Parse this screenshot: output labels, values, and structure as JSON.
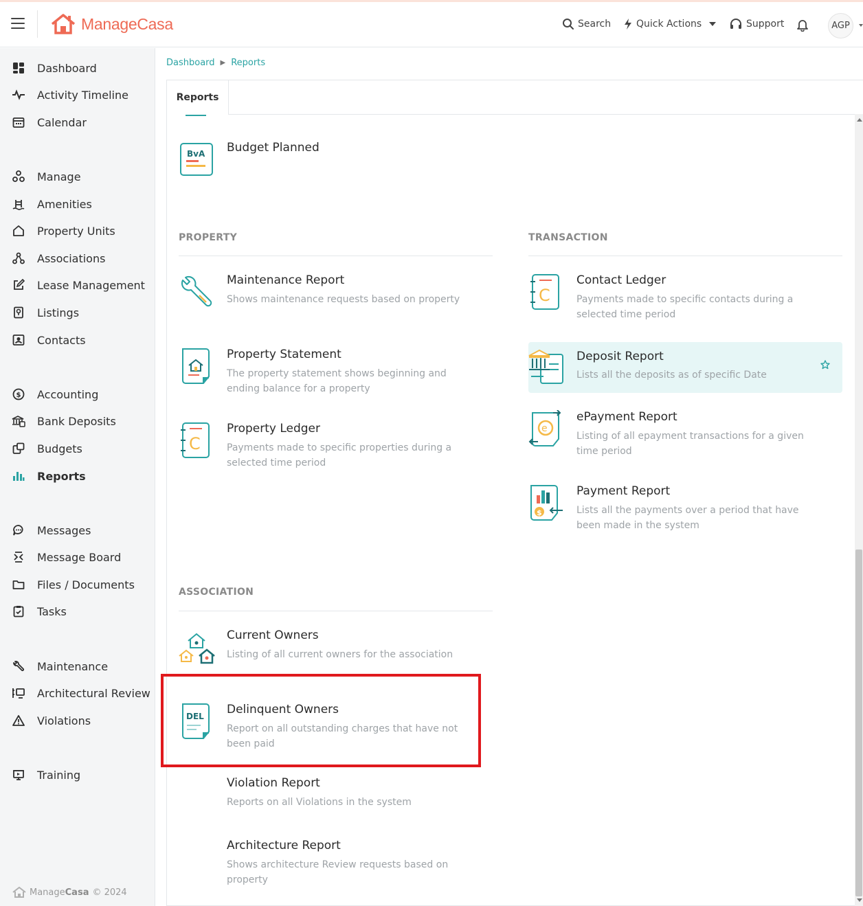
{
  "header": {
    "brand": "ManageCasa",
    "search": "Search",
    "quick_actions": "Quick Actions",
    "support": "Support",
    "avatar": "AGP"
  },
  "sidebar": {
    "items": [
      {
        "label": "Dashboard",
        "icon": "dashboard-icon"
      },
      {
        "label": "Activity Timeline",
        "icon": "pulse-icon"
      },
      {
        "label": "Calendar",
        "icon": "calendar-icon"
      },
      {
        "label": "Manage",
        "icon": "manage-icon"
      },
      {
        "label": "Amenities",
        "icon": "pool-icon"
      },
      {
        "label": "Property Units",
        "icon": "home-icon"
      },
      {
        "label": "Associations",
        "icon": "network-icon"
      },
      {
        "label": "Lease Management",
        "icon": "edit-icon"
      },
      {
        "label": "Listings",
        "icon": "listing-icon"
      },
      {
        "label": "Contacts",
        "icon": "contact-card-icon"
      },
      {
        "label": "Accounting",
        "icon": "dollar-icon"
      },
      {
        "label": "Bank Deposits",
        "icon": "bank-icon"
      },
      {
        "label": "Budgets",
        "icon": "budget-icon"
      },
      {
        "label": "Reports",
        "icon": "bar-chart-icon"
      },
      {
        "label": "Messages",
        "icon": "chat-icon"
      },
      {
        "label": "Message Board",
        "icon": "board-icon"
      },
      {
        "label": "Files / Documents",
        "icon": "folder-icon"
      },
      {
        "label": "Tasks",
        "icon": "task-icon"
      },
      {
        "label": "Maintenance",
        "icon": "wrench-icon"
      },
      {
        "label": "Architectural Review",
        "icon": "review-icon"
      },
      {
        "label": "Violations",
        "icon": "warning-icon"
      },
      {
        "label": "Training",
        "icon": "training-icon"
      }
    ],
    "footer_brand_light": "Manage",
    "footer_brand_bold": "Casa",
    "footer_copyright": "© 2024"
  },
  "breadcrumb": [
    "Dashboard",
    "Reports"
  ],
  "tabs": [
    "Reports"
  ],
  "sections": {
    "property": "PROPERTY",
    "transaction": "TRANSACTION",
    "association": "ASSOCIATION"
  },
  "reports": {
    "budget_planned": {
      "title": "Budget Planned",
      "icon_text": "BvA"
    },
    "maintenance": {
      "title": "Maintenance Report",
      "desc": "Shows maintenance requests based on property"
    },
    "property_statement": {
      "title": "Property Statement",
      "desc": "The property statement shows beginning and ending balance for a property"
    },
    "property_ledger": {
      "title": "Property Ledger",
      "desc": "Payments made to specific properties during a selected time period"
    },
    "contact_ledger": {
      "title": "Contact Ledger",
      "desc": "Payments made to specific contacts during a selected time period"
    },
    "deposit": {
      "title": "Deposit Report",
      "desc": "Lists all the deposits as of specific Date"
    },
    "epayment": {
      "title": "ePayment Report",
      "desc": "Listing of all epayment transactions for a given time period"
    },
    "payment": {
      "title": "Payment Report",
      "desc": "Lists all the payments over a period that have been made in the system"
    },
    "current_owners": {
      "title": "Current Owners",
      "desc": "Listing of all current owners for the association"
    },
    "delinquent_owners": {
      "title": "Delinquent Owners",
      "desc": "Report on all outstanding charges that have not been paid",
      "icon_text": "DEL"
    },
    "violation": {
      "title": "Violation Report",
      "desc": "Reports on all Violations in the system"
    },
    "architecture": {
      "title": "Architecture Report",
      "desc": "Shows architecture Review requests based on property"
    }
  },
  "colors": {
    "accent": "#2aa3a3",
    "brand": "#ee6a55",
    "highlight": "#e6f6f6",
    "annotation": "#e0191d"
  }
}
